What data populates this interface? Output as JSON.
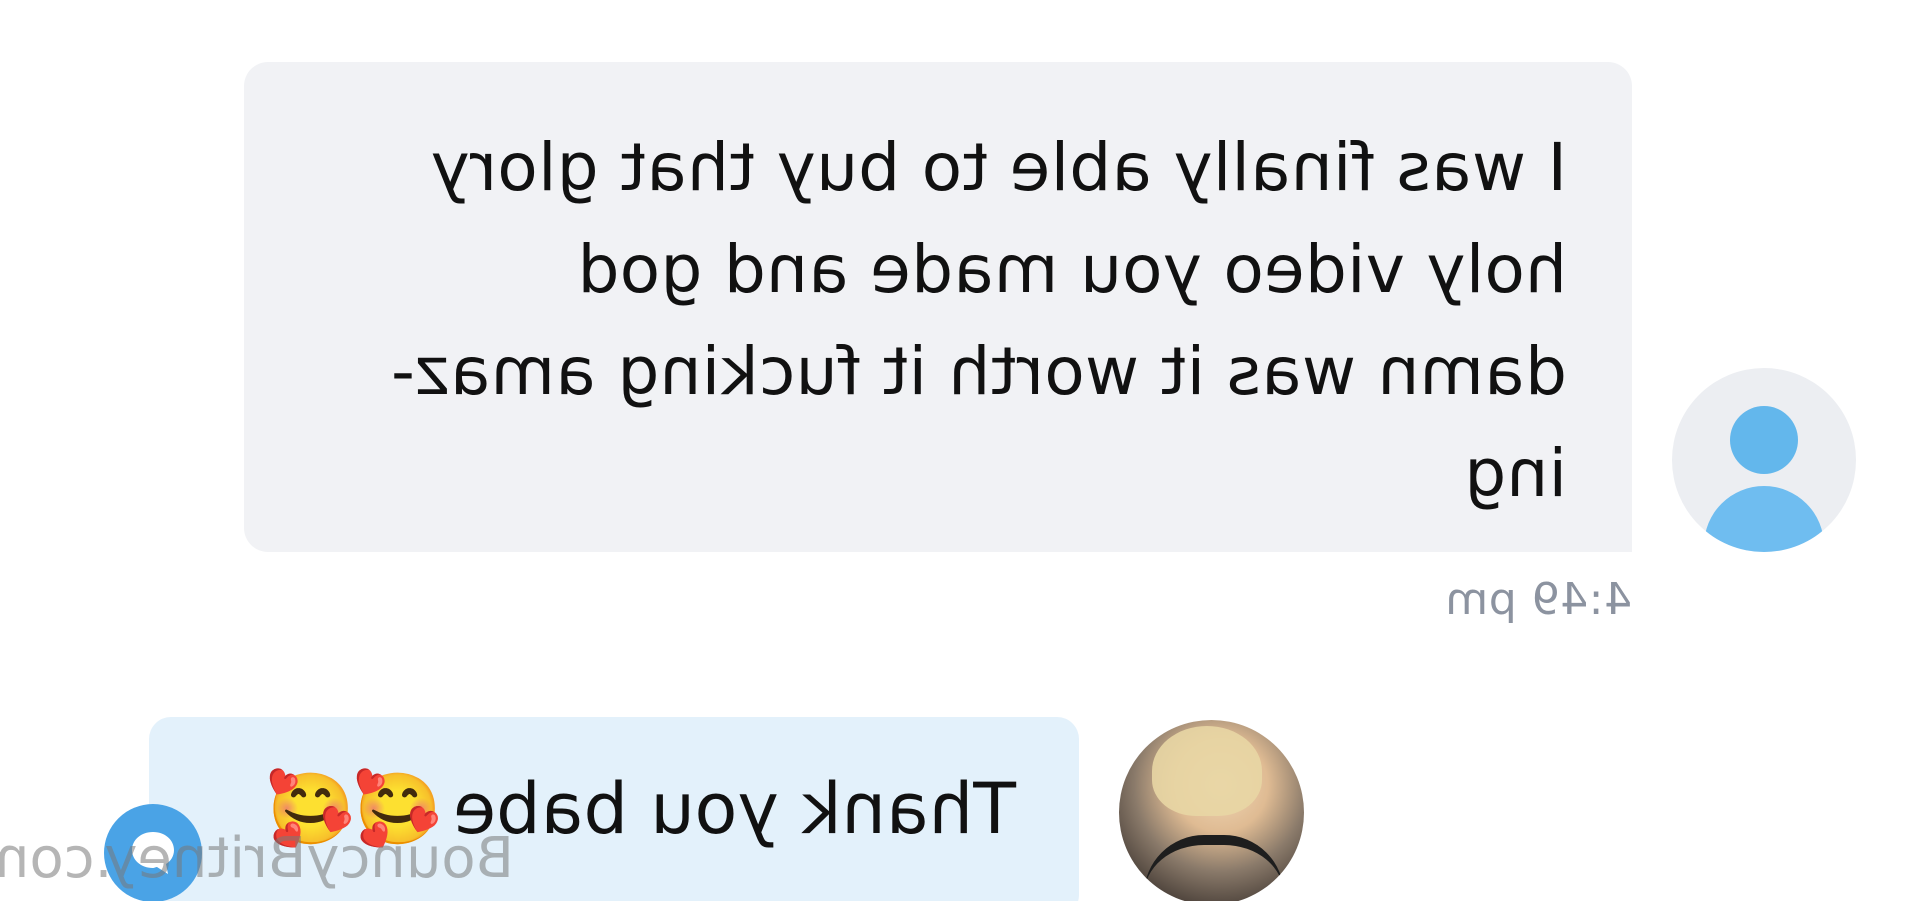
{
  "messages": [
    {
      "sender": "user",
      "text": "I was finally able to buy that glory\nholy video you made and god\ndamn was it worth it fucking amaz-\ning",
      "time": "4:49 pm",
      "avatar_icon": "default-user-avatar-icon"
    },
    {
      "sender": "creator",
      "text": "Thank you babe",
      "emoji": "🥰🥰",
      "avatar_icon": "creator-profile-photo"
    }
  ],
  "watermark": "BouncyBritney.com",
  "fab_icon": "chat-bubble-icon",
  "colors": {
    "incoming_bubble": "#f1f2f5",
    "outgoing_bubble": "#e3f1fb",
    "timestamp": "#8c93a0",
    "accent": "#4aa3e6"
  }
}
